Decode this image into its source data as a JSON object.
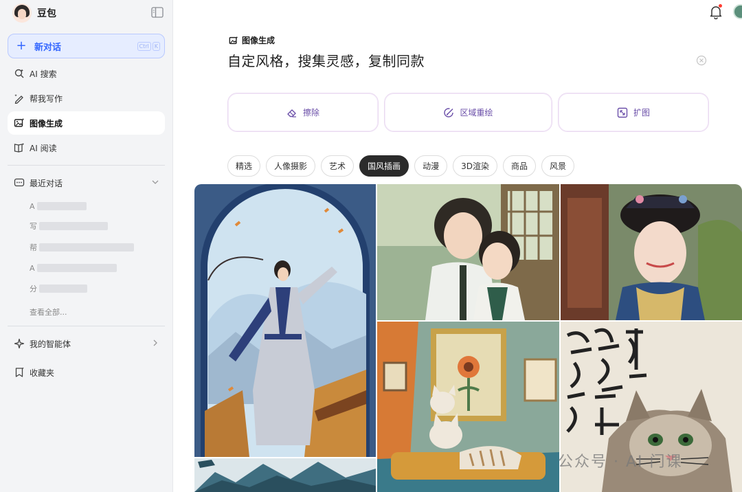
{
  "sidebar": {
    "brand_name": "豆包",
    "new_chat": {
      "label": "新对话",
      "kbd": [
        "Ctrl",
        "K"
      ]
    },
    "nav": [
      {
        "label": "AI 搜索",
        "icon": "ai-search-icon"
      },
      {
        "label": "帮我写作",
        "icon": "pen-icon"
      },
      {
        "label": "图像生成",
        "icon": "image-gen-icon"
      },
      {
        "label": "AI 阅读",
        "icon": "book-icon"
      }
    ],
    "recent_title": "最近对话",
    "recent_first_chars": [
      "A",
      "写",
      "帮",
      "A",
      "分"
    ],
    "see_all": "查看全部...",
    "agents": "我的智能体",
    "favorites": "收藏夹"
  },
  "main": {
    "tag": "图像生成",
    "prompt": "自定风格，搜集灵感，复制同款",
    "tools": [
      {
        "label": "擦除",
        "icon": "eraser-icon"
      },
      {
        "label": "区域重绘",
        "icon": "repaint-icon"
      },
      {
        "label": "扩图",
        "icon": "expand-icon"
      }
    ],
    "chips": [
      "精选",
      "人像摄影",
      "艺术",
      "国风插画",
      "动漫",
      "3D渲染",
      "商品",
      "风景"
    ],
    "active_chip": "国风插画",
    "watermark": "公众号 · AI 门课"
  },
  "colors": {
    "accent": "#3366ff",
    "tool_text": "#6a4ea8",
    "chip_active_bg": "#2b2b2b",
    "notification_dot": "#ff3b30"
  }
}
